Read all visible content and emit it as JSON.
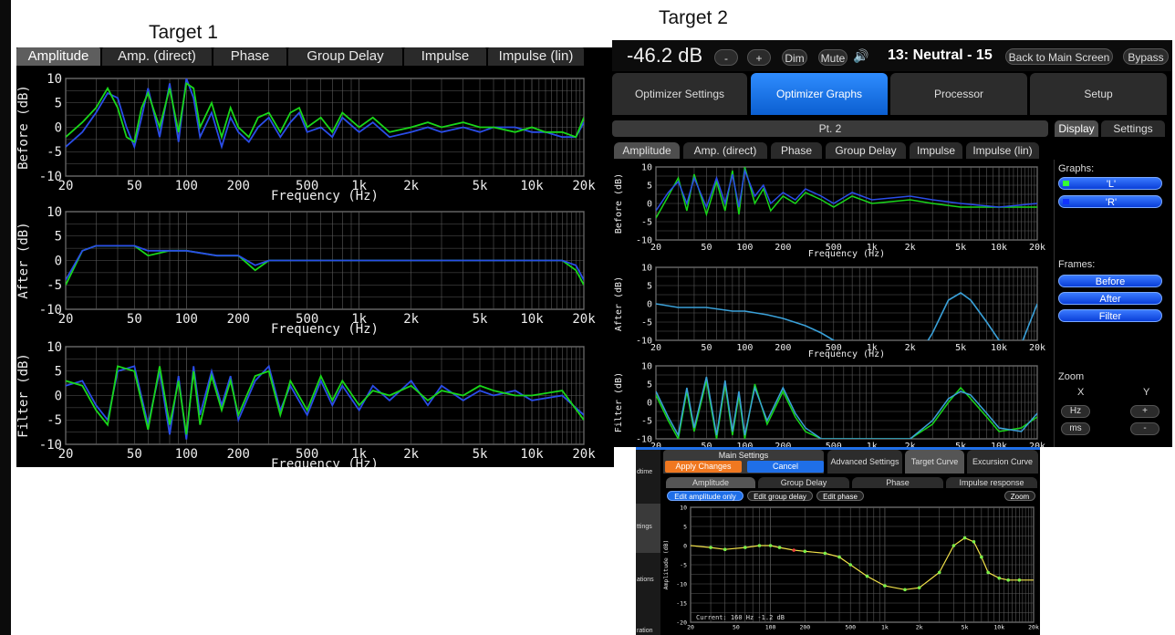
{
  "slide": {
    "target1_label": "Target 1",
    "target2_label": "Target 2"
  },
  "target1": {
    "tabs": [
      "Amplitude",
      "Amp. (direct)",
      "Phase",
      "Group Delay",
      "Impulse",
      "Impulse (lin)"
    ],
    "active_tab": "Amplitude",
    "charts": [
      {
        "ylabel": "Before (dB)",
        "xlabel": "Frequency (Hz)"
      },
      {
        "ylabel": "After (dB)",
        "xlabel": "Frequency (Hz)"
      },
      {
        "ylabel": "Filter (dB)",
        "xlabel": "Frequency (Hz)"
      }
    ]
  },
  "target2": {
    "volume": "-46.2 dB",
    "minus_label": "-",
    "plus_label": "+",
    "dim_label": "Dim",
    "mute_label": "Mute",
    "preset": "13: Neutral - 15",
    "back_label": "Back to Main Screen",
    "bypass_label": "Bypass",
    "nav_tabs": [
      "Optimizer Settings",
      "Optimizer Graphs",
      "Processor",
      "Setup"
    ],
    "active_nav": "Optimizer Graphs",
    "point_label": "Pt. 2",
    "side_tabs": [
      "Display",
      "Settings"
    ],
    "graph_tabs": [
      "Amplitude",
      "Amp. (direct)",
      "Phase",
      "Group Delay",
      "Impulse",
      "Impulse (lin)"
    ],
    "graphs_header": "Graphs:",
    "graph_buttons": [
      "'L'",
      "'R'"
    ],
    "frames_header": "Frames:",
    "frame_buttons": [
      "Before",
      "After",
      "Filter"
    ],
    "zoom_header": "Zoom",
    "zoom_x": "X",
    "zoom_y": "Y",
    "zoom_hz": "Hz",
    "zoom_ms": "ms",
    "zoom_plus": "+",
    "zoom_minus": "-",
    "charts": [
      {
        "ylabel": "Before (dB)",
        "xlabel": "Frequency (Hz)"
      },
      {
        "ylabel": "After (dB)",
        "xlabel": "Frequency (Hz)"
      },
      {
        "ylabel": "Filter (dB)",
        "xlabel": ""
      }
    ]
  },
  "target3": {
    "main_settings": "Main Settings",
    "apply_label": "Apply Changes",
    "cancel_label": "Cancel",
    "nav_tabs": [
      "Advanced Settings",
      "Target Curve",
      "Excursion Curve"
    ],
    "active_nav": "Target Curve",
    "graph_tabs": [
      "Amplitude",
      "Group Delay",
      "Phase",
      "Impulse response"
    ],
    "edit_buttons": [
      "Edit amplitude only",
      "Edit group delay",
      "Edit phase"
    ],
    "zoom_label": "Zoom",
    "left_fragments": [
      "dtime",
      "ttings",
      "ations",
      "ration"
    ],
    "ylabel": "Amplitude (dB)",
    "status": "Current:  160 Hz   -1.2 dB"
  },
  "axes": {
    "freq_ticks": [
      "20",
      "50",
      "100",
      "200",
      "500",
      "1k",
      "2k",
      "5k",
      "10k",
      "20k"
    ],
    "freq_tick_values": [
      20,
      50,
      100,
      200,
      500,
      1000,
      2000,
      5000,
      10000,
      20000
    ],
    "db_ticks": [
      "10",
      "5",
      "0",
      "-5",
      "-10"
    ],
    "target_db_ticks": [
      "10",
      "5",
      "0",
      "-5",
      "-10",
      "-15",
      "-20"
    ]
  },
  "colors": {
    "series_L": "#19d619",
    "series_R": "#2a4de8",
    "after_series": "#3aa0d8",
    "target_curve": "#f2e24a",
    "target_point": "#7cf04a",
    "target_point_active": "#e84040",
    "accent_blue": "#1f6fe8",
    "apply_orange": "#f07820"
  },
  "chart_data": [
    {
      "type": "line",
      "title": "",
      "xlabel": "Frequency (Hz)",
      "ylabel": "Before (dB)",
      "xscale": "log",
      "xlim": [
        20,
        20000
      ],
      "ylim": [
        -10,
        10
      ],
      "series": [
        {
          "x": [
            20,
            25,
            30,
            35,
            40,
            45,
            50,
            55,
            60,
            70,
            80,
            90,
            100,
            110,
            120,
            140,
            160,
            180,
            200,
            230,
            260,
            300,
            350,
            400,
            450,
            500,
            600,
            700,
            800,
            1000,
            1200,
            1500,
            2000,
            2500,
            3000,
            4000,
            5000,
            6000,
            8000,
            10000,
            12000,
            15000,
            18000,
            20000
          ],
          "y": [
            -4,
            -1,
            3,
            7,
            6,
            0,
            -4,
            2,
            8,
            -2,
            9,
            -3,
            10,
            6,
            -2,
            3,
            -4,
            2,
            -1,
            -3,
            0,
            2,
            -2,
            1,
            3,
            -1,
            0,
            -2,
            2,
            -1,
            1,
            -2,
            -1,
            0,
            -1,
            0,
            -1,
            0,
            0,
            -1,
            -1,
            -2,
            -2,
            1
          ]
        },
        {
          "x": [
            20,
            25,
            30,
            35,
            40,
            45,
            50,
            55,
            60,
            70,
            80,
            90,
            100,
            110,
            120,
            140,
            160,
            180,
            200,
            230,
            260,
            300,
            350,
            400,
            450,
            500,
            600,
            700,
            800,
            1000,
            1200,
            1500,
            2000,
            2500,
            3000,
            4000,
            5000,
            6000,
            8000,
            10000,
            12000,
            15000,
            18000,
            20000
          ],
          "y": [
            -2,
            1,
            4,
            8,
            4,
            -2,
            -3,
            4,
            7,
            0,
            8,
            -1,
            9,
            8,
            0,
            5,
            -2,
            4,
            0,
            -2,
            2,
            3,
            -1,
            3,
            4,
            0,
            2,
            -1,
            3,
            0,
            2,
            -1,
            0,
            1,
            0,
            1,
            0,
            0,
            -1,
            0,
            -1,
            -1,
            -2,
            2
          ]
        }
      ]
    },
    {
      "type": "line",
      "title": "",
      "xlabel": "Frequency (Hz)",
      "ylabel": "After (dB)",
      "xscale": "log",
      "xlim": [
        20,
        20000
      ],
      "ylim": [
        -10,
        10
      ],
      "series": [
        {
          "x": [
            20,
            25,
            30,
            40,
            50,
            60,
            80,
            100,
            150,
            200,
            250,
            300,
            400,
            500,
            700,
            1000,
            2000,
            5000,
            10000,
            15000,
            18000,
            20000
          ],
          "y": [
            -5,
            2,
            3,
            3,
            3,
            1,
            2,
            2,
            1,
            1,
            -2,
            0,
            0,
            0,
            0,
            0,
            0,
            0,
            0,
            0,
            -2,
            -5
          ]
        },
        {
          "x": [
            20,
            25,
            30,
            40,
            50,
            60,
            80,
            100,
            150,
            200,
            250,
            300,
            400,
            500,
            700,
            1000,
            2000,
            5000,
            10000,
            15000,
            18000,
            20000
          ],
          "y": [
            -4,
            2,
            3,
            3,
            3,
            2,
            2,
            2,
            1,
            1,
            -1,
            0,
            0,
            0,
            0,
            0,
            0,
            0,
            0,
            0,
            -1,
            -4
          ]
        }
      ]
    },
    {
      "type": "line",
      "title": "",
      "xlabel": "Frequency (Hz)",
      "ylabel": "Filter (dB)",
      "xscale": "log",
      "xlim": [
        20,
        20000
      ],
      "ylim": [
        -10,
        10
      ],
      "series": [
        {
          "x": [
            20,
            25,
            30,
            35,
            40,
            50,
            60,
            70,
            80,
            90,
            100,
            110,
            120,
            140,
            160,
            180,
            200,
            250,
            300,
            350,
            400,
            500,
            600,
            700,
            800,
            1000,
            1200,
            1500,
            2000,
            2500,
            3000,
            4000,
            5000,
            6000,
            8000,
            10000,
            15000,
            20000
          ],
          "y": [
            2,
            3,
            -2,
            -5,
            5,
            6,
            -6,
            5,
            -8,
            4,
            -9,
            6,
            -4,
            5,
            -2,
            4,
            -5,
            3,
            6,
            -3,
            2,
            -4,
            3,
            -2,
            2,
            -3,
            2,
            -1,
            3,
            -2,
            2,
            -1,
            1,
            0,
            1,
            -1,
            0,
            -4
          ]
        },
        {
          "x": [
            20,
            25,
            30,
            35,
            40,
            50,
            60,
            70,
            80,
            90,
            100,
            110,
            120,
            140,
            160,
            180,
            200,
            250,
            300,
            350,
            400,
            500,
            600,
            700,
            800,
            1000,
            1200,
            1500,
            2000,
            2500,
            3000,
            4000,
            5000,
            6000,
            8000,
            10000,
            15000,
            20000
          ],
          "y": [
            3,
            2,
            -3,
            -6,
            6,
            5,
            -7,
            6,
            -6,
            3,
            -8,
            5,
            -6,
            4,
            -3,
            3,
            -4,
            4,
            5,
            -4,
            3,
            -3,
            4,
            -1,
            3,
            -2,
            1,
            0,
            2,
            -1,
            1,
            0,
            2,
            1,
            0,
            0,
            1,
            -5
          ]
        }
      ]
    },
    {
      "type": "line",
      "title": "",
      "xlabel": "Frequency (Hz)",
      "ylabel": "Before (dB)",
      "xscale": "log",
      "xlim": [
        20,
        20000
      ],
      "ylim": [
        -10,
        10
      ],
      "series": [
        {
          "x": [
            20,
            25,
            30,
            35,
            40,
            50,
            60,
            70,
            80,
            90,
            100,
            120,
            140,
            160,
            200,
            250,
            300,
            400,
            500,
            700,
            1000,
            2000,
            3000,
            5000,
            10000,
            20000
          ],
          "y": [
            -4,
            2,
            7,
            -2,
            8,
            -3,
            6,
            -2,
            9,
            -3,
            10,
            0,
            4,
            -2,
            2,
            0,
            3,
            1,
            -1,
            2,
            0,
            1,
            0,
            -1,
            -1,
            -1
          ]
        },
        {
          "x": [
            20,
            25,
            30,
            35,
            40,
            50,
            60,
            70,
            80,
            90,
            100,
            120,
            140,
            160,
            200,
            250,
            300,
            400,
            500,
            700,
            1000,
            2000,
            3000,
            5000,
            10000,
            20000
          ],
          "y": [
            -2,
            3,
            6,
            0,
            7,
            -1,
            7,
            0,
            8,
            -1,
            9,
            2,
            5,
            0,
            3,
            1,
            4,
            2,
            0,
            3,
            1,
            2,
            1,
            0,
            -1,
            0
          ]
        }
      ]
    },
    {
      "type": "line",
      "title": "",
      "xlabel": "Frequency (Hz)",
      "ylabel": "After (dB)",
      "xscale": "log",
      "xlim": [
        20,
        20000
      ],
      "ylim": [
        -10,
        10
      ],
      "series": [
        {
          "x": [
            20,
            30,
            50,
            80,
            100,
            150,
            200,
            300,
            400,
            500,
            700,
            1000,
            1500,
            2000,
            3000,
            4000,
            5000,
            6000,
            8000,
            10000,
            15000,
            20000
          ],
          "y": [
            0,
            -1,
            -1,
            -2,
            -2,
            -3,
            -4,
            -6,
            -8,
            -10,
            -12,
            -14,
            -16,
            -18,
            -8,
            1,
            3,
            1,
            -5,
            -10,
            -11,
            0
          ]
        }
      ]
    },
    {
      "type": "line",
      "title": "",
      "xlabel": "",
      "ylabel": "Filter (dB)",
      "xscale": "log",
      "xlim": [
        20,
        20000
      ],
      "ylim": [
        -10,
        10
      ],
      "series": [
        {
          "x": [
            20,
            25,
            30,
            35,
            40,
            50,
            60,
            70,
            80,
            90,
            100,
            120,
            150,
            200,
            250,
            300,
            400,
            500,
            700,
            1000,
            2000,
            3000,
            4000,
            5000,
            6000,
            8000,
            10000,
            15000,
            20000
          ],
          "y": [
            2,
            -5,
            -10,
            3,
            -8,
            6,
            -10,
            5,
            -9,
            2,
            -10,
            5,
            -6,
            3,
            -4,
            -8,
            -10,
            -10,
            -10,
            -10,
            -10,
            -6,
            0,
            4,
            1,
            -4,
            -8,
            -7,
            -4
          ]
        },
        {
          "x": [
            20,
            25,
            30,
            35,
            40,
            50,
            60,
            70,
            80,
            90,
            100,
            120,
            150,
            200,
            250,
            300,
            400,
            500,
            700,
            1000,
            2000,
            3000,
            4000,
            5000,
            6000,
            8000,
            10000,
            15000,
            20000
          ],
          "y": [
            3,
            -4,
            -9,
            4,
            -7,
            7,
            -9,
            6,
            -8,
            3,
            -9,
            4,
            -5,
            4,
            -3,
            -7,
            -10,
            -10,
            -10,
            -10,
            -10,
            -5,
            1,
            3,
            2,
            -3,
            -7,
            -8,
            -3
          ]
        }
      ]
    },
    {
      "type": "line",
      "title": "",
      "xlabel": "",
      "ylabel": "Amplitude (dB)",
      "xscale": "log",
      "xlim": [
        20,
        20000
      ],
      "ylim": [
        -20,
        10
      ],
      "series": [
        {
          "x": [
            20,
            30,
            40,
            60,
            80,
            100,
            120,
            160,
            200,
            300,
            400,
            500,
            700,
            1000,
            1500,
            2000,
            3000,
            4000,
            5000,
            6000,
            7000,
            8000,
            10000,
            12000,
            15000,
            20000
          ],
          "y": [
            0,
            -0.5,
            -1,
            -0.5,
            0,
            0,
            -0.5,
            -1.2,
            -1.5,
            -2,
            -3,
            -5,
            -8,
            -10.5,
            -11.5,
            -11,
            -7,
            0,
            2,
            1,
            -3,
            -7,
            -8.5,
            -9,
            -9,
            -9
          ]
        }
      ]
    }
  ]
}
